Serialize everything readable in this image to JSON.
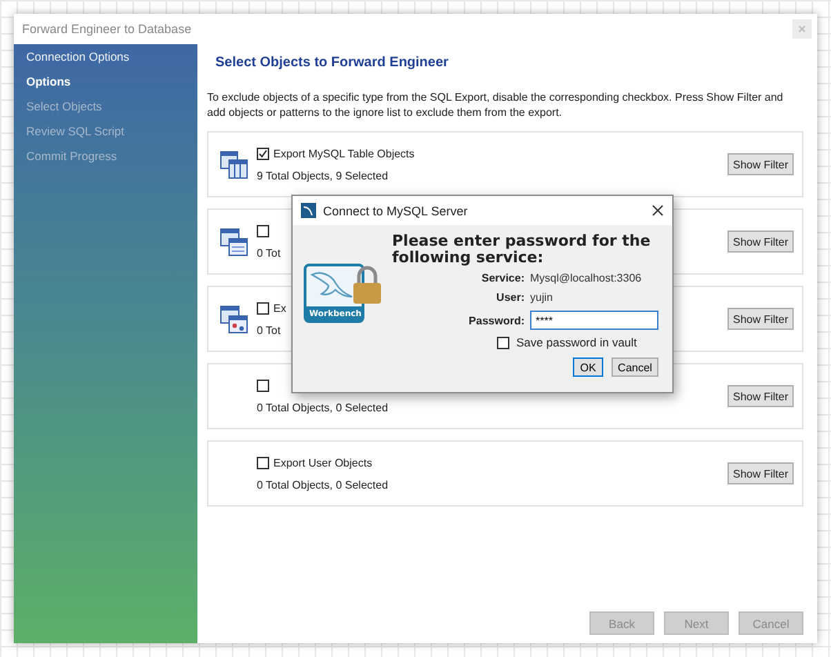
{
  "window": {
    "title": "Forward Engineer to Database"
  },
  "sidebar": {
    "items": [
      {
        "label": "Connection Options",
        "selected": false,
        "disabled": false
      },
      {
        "label": "Options",
        "selected": true,
        "disabled": false
      },
      {
        "label": "Select Objects",
        "selected": false,
        "disabled": true
      },
      {
        "label": "Review SQL Script",
        "selected": false,
        "disabled": true
      },
      {
        "label": "Commit Progress",
        "selected": false,
        "disabled": true
      }
    ]
  },
  "heading": "Select Objects to Forward Engineer",
  "description": "To exclude objects of a specific type from the SQL Export, disable the corresponding checkbox. Press Show Filter and add objects or patterns to the ignore list to exclude them from the export.",
  "object_groups": [
    {
      "label": "Export MySQL Table Objects",
      "checked": true,
      "count": "9 Total Objects, 9 Selected",
      "button": "Show Filter"
    },
    {
      "checked": false,
      "count": "0 Tot",
      "button": "Show Filter"
    },
    {
      "label": "Ex",
      "checked": false,
      "count": "0 Tot",
      "button": "Show Filter"
    },
    {
      "checked": false,
      "count": "0 Total Objects, 0 Selected",
      "button": "Show Filter"
    },
    {
      "label": "Export User Objects",
      "checked": false,
      "count": "0 Total Objects, 0 Selected",
      "button": "Show Filter"
    }
  ],
  "buttons": [
    {
      "label": "Back",
      "disabled": true
    },
    {
      "label": "Next",
      "disabled": true
    },
    {
      "label": "Cancel",
      "disabled": true
    }
  ],
  "password_dialog": {
    "title": "Connect to MySQL Server",
    "logo_text": "Workbench",
    "message": "Please enter password for the following service:",
    "fields": [
      {
        "label": "Service:",
        "value": "Mysql@localhost:3306",
        "kind": "text"
      },
      {
        "label": "User:",
        "value": "yujin",
        "kind": "text"
      },
      {
        "label": "Password:",
        "value": "****",
        "kind": "input"
      }
    ],
    "save_password": {
      "label": "Save password in vault",
      "checked": false
    },
    "buttons": [
      {
        "label": "OK",
        "default": true
      },
      {
        "label": "Cancel",
        "default": false
      }
    ]
  }
}
